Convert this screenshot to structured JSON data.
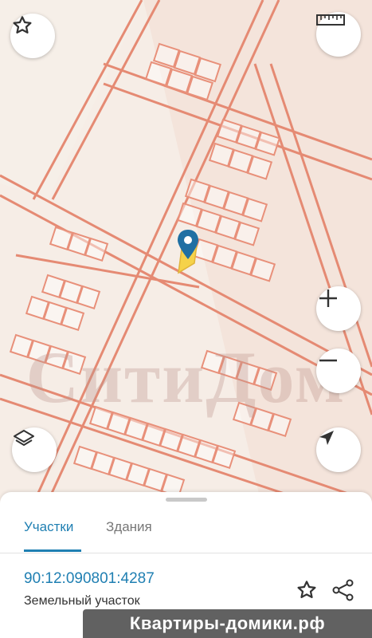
{
  "map": {
    "watermark": "СитиДом",
    "accent_color": "#e8735a",
    "marker_color": "#1f6fa3",
    "highlight_color": "#f5d24a"
  },
  "controls": {
    "favorite_icon": "star-outline-icon",
    "measure_icon": "ruler-icon",
    "zoom_in_icon": "plus-icon",
    "zoom_out_icon": "minus-icon",
    "layers_icon": "layers-icon",
    "locate_icon": "navigation-arrow-icon"
  },
  "sheet": {
    "tabs": [
      {
        "label": "Участки",
        "active": true
      },
      {
        "label": "Здания",
        "active": false
      }
    ],
    "parcel": {
      "number": "90:12:090801:4287",
      "type": "Земельный участок"
    },
    "actions": [
      "star-outline-icon",
      "share-icon"
    ]
  },
  "banner": {
    "text": "Квартиры-домики.рф"
  }
}
